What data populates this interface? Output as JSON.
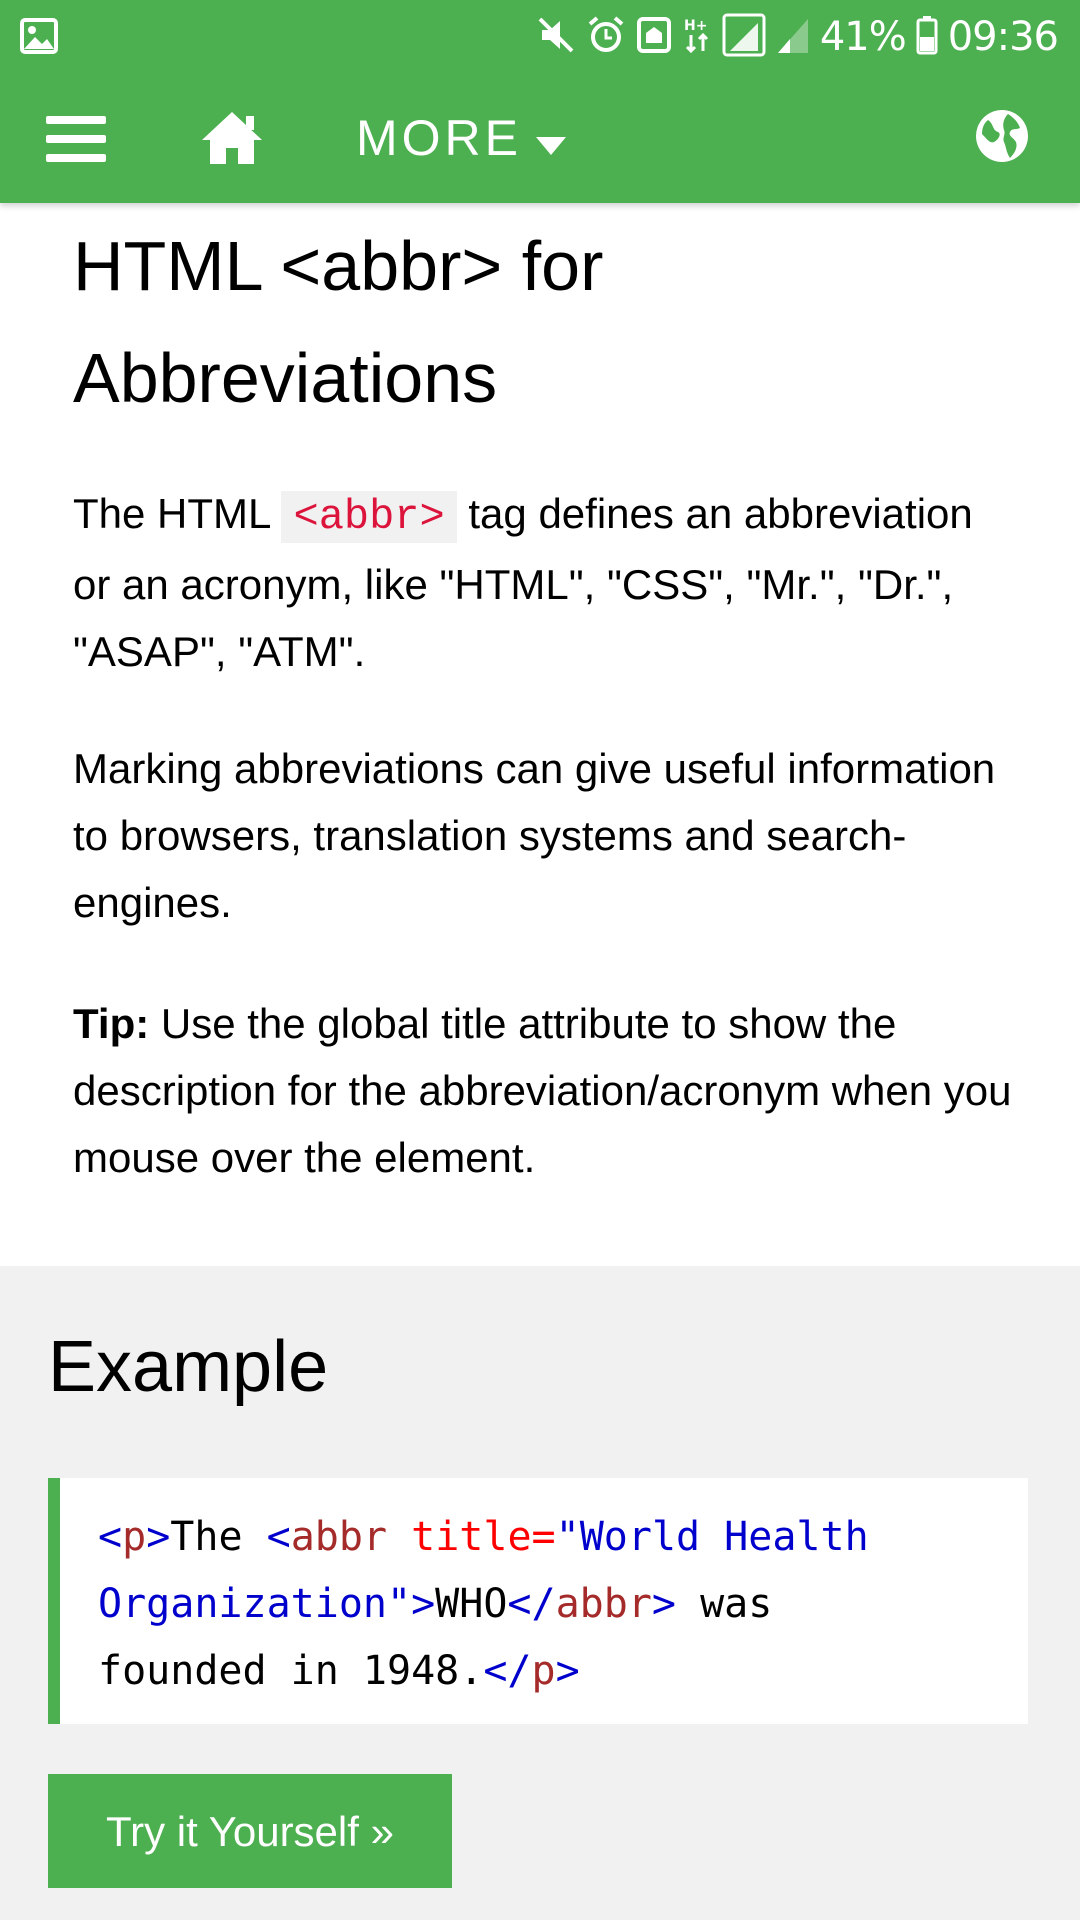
{
  "status_bar": {
    "battery_text": "41%",
    "time": "09:36",
    "icons": [
      "gallery-icon",
      "mute-icon",
      "alarm-icon",
      "nfc-icon",
      "data-arrows-icon",
      "signal-icon",
      "signal-weak-icon",
      "battery-icon"
    ]
  },
  "nav": {
    "more_label": "MORE",
    "icons": [
      "menu-icon",
      "home-icon",
      "caret-down-icon",
      "globe-icon"
    ]
  },
  "article": {
    "title_line1": "HTML <abbr> for",
    "title_line2": "Abbreviations",
    "p1_before": "The HTML ",
    "p1_code": "<abbr>",
    "p1_after": " tag defines an abbreviation or an acronym, like \"HTML\", \"CSS\", \"Mr.\", \"Dr.\", \"ASAP\", \"ATM\".",
    "p2": "Marking abbreviations can give useful information to browsers, translation systems and search-engines.",
    "p3_bold": "Tip:",
    "p3_rest": " Use the global title attribute to show the description for the abbreviation/acronym when you mouse over the element."
  },
  "example": {
    "title": "Example",
    "code": {
      "l1_open": "<",
      "l1_p": "p",
      "l1_close": ">",
      "l1_text": "The ",
      "l1_abbr_open": "<",
      "l1_abbr": "abbr",
      "l1_attr": " title=",
      "l1_val": "\"World Health",
      "l2_val": "Organization\"",
      "l2_gt": ">",
      "l2_text": "WHO",
      "l2_end_open": "</",
      "l2_end_abbr": "abbr",
      "l2_end_close": ">",
      "l2_after": " was",
      "l3_text": "founded in 1948.",
      "l3_end_open": "</",
      "l3_end_p": "p",
      "l3_end_close": ">"
    },
    "try_button": "Try it Yourself »"
  },
  "colors": {
    "brand_green": "#4caf50",
    "inline_code_red": "#dc143c",
    "tag_blue": "#0000cd",
    "tag_name_brown": "#a52a2a",
    "attr_red": "#ff0000",
    "example_bg": "#f1f1f1"
  }
}
